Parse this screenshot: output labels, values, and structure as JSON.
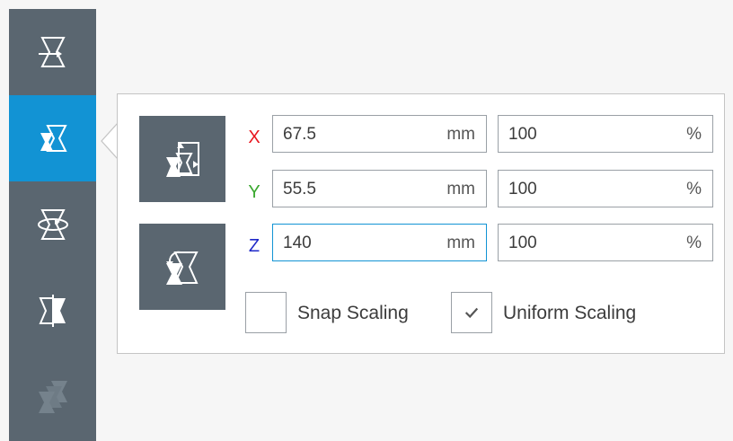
{
  "toolbar": {
    "tools": [
      {
        "name": "move",
        "icon": "move-tool-icon",
        "active": false
      },
      {
        "name": "scale",
        "icon": "scale-tool-icon",
        "active": true
      },
      {
        "name": "rotate",
        "icon": "rotate-tool-icon",
        "active": false
      },
      {
        "name": "mirror",
        "icon": "mirror-tool-icon",
        "active": false
      },
      {
        "name": "per-model-settings",
        "icon": "per-model-settings-icon",
        "active": false,
        "disabled": true
      }
    ]
  },
  "scale_panel": {
    "buttons": {
      "lay_flat_icon": "scale-to-max-icon",
      "reset_icon": "reset-scale-icon"
    },
    "rows": [
      {
        "axis": "X",
        "color": "#e8161e",
        "mm": "67.5",
        "mm_unit": "mm",
        "percent": "100",
        "percent_unit": "%"
      },
      {
        "axis": "Y",
        "color": "#3aa82f",
        "mm": "55.5",
        "mm_unit": "mm",
        "percent": "100",
        "percent_unit": "%"
      },
      {
        "axis": "Z",
        "color": "#1e28c8",
        "mm": "140",
        "mm_unit": "mm",
        "percent": "100",
        "percent_unit": "%"
      }
    ],
    "snap_scaling": {
      "label": "Snap Scaling",
      "checked": false
    },
    "uniform_scaling": {
      "label": "Uniform Scaling",
      "checked": true
    }
  },
  "colors": {
    "toolbar_bg": "#5a6670",
    "accent": "#1293d4",
    "panel_bg": "#ffffff",
    "page_bg": "#f6f6f6"
  }
}
